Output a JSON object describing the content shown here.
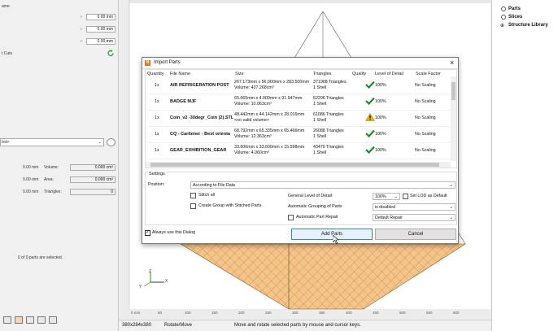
{
  "left_panel": {
    "name_label": "ame",
    "fields": [
      "0.00 mm",
      "0.00 mm",
      "0.00 mm"
    ],
    "cuts_label": "t Cuts",
    "dropdown_value": "led>",
    "stats": [
      {
        "value": "0.00 mm",
        "label": "Volume:",
        "box": "0.000 cm³"
      },
      {
        "value": "0.00 mm",
        "label": "Area:",
        "box": "0.000 cm²"
      },
      {
        "value": "0.00 mm",
        "label": "Triangles:",
        "box": "0"
      }
    ],
    "selection_text": "0 of 0 parts are selected."
  },
  "right_panel": {
    "tree": [
      "Parts",
      "Slices",
      "Structure Library"
    ]
  },
  "viewport": {
    "ruler_ticks": [
      "0 mm",
      "50",
      "100",
      "150",
      "200",
      "250",
      "300",
      "350",
      "400",
      "450",
      "500",
      "550",
      "600"
    ]
  },
  "status": {
    "dimensions": "380x284x380",
    "mode": "Rotate/Move",
    "hint": "Move and rotate selected parts by mouse and cursor keys."
  },
  "dialog": {
    "title": "Import Parts",
    "close": "×",
    "headers": {
      "quantity": "Quantity",
      "filename": "File Name",
      "size": "Size",
      "triangles": "Triangles",
      "quality": "Quality",
      "level": "Level of Detail",
      "scale": "Scale Factor"
    },
    "rows": [
      {
        "qty": "1x",
        "name": "AIR REFRIGERATION POST",
        "size1": "267.173mm x 56.000mm x 283.500mm",
        "size2": "Volume: 437.268cm³",
        "tri1": "371908 Triangles",
        "tri2": "1 Shell",
        "quality": "ok",
        "level": "100%",
        "scale": "No Scaling"
      },
      {
        "qty": "1x",
        "name": "BADGE MJF",
        "size1": "65.665mm x 4.000mm x 91.947mm",
        "size2": "Volume: 10.063cm³",
        "tri1": "52296 Triangles",
        "tri2": "1 Shell",
        "quality": "ok",
        "level": "100%",
        "scale": "No Scaling"
      },
      {
        "qty": "1x",
        "name": "Coin_v2 -30degr_Coin (2).STL",
        "size1": "48.442mm x 44.142mm x 28.016mm",
        "size2": "<no valid volume>",
        "tri1": "61086 Triangles",
        "tri2": "1 Shell",
        "quality": "warn",
        "level": "100%",
        "scale": "No Scaling"
      },
      {
        "qty": "1x",
        "name": "CQ - Caribiner - Best orienta",
        "size1": "68.792mm x 65.335mm x 65.466mm",
        "size2": "Volume: 12.363cm³",
        "tri1": "26088 Triangles",
        "tri2": "1 Shell",
        "quality": "ok",
        "level": "100%",
        "scale": "No Scaling"
      },
      {
        "qty": "1x",
        "name": "GEAR_EXHIBITION_GEAR",
        "size1": "33.600mm x 33.600mm x 15.598mm",
        "size2": "Volume: 4.060cm³",
        "tri1": "43470 Triangles",
        "tri2": "1 Shell",
        "quality": "ok",
        "level": "100%",
        "scale": "No Scaling"
      }
    ],
    "settings_label": "Settings",
    "position_label": "Position:",
    "position_value": "According to File Data",
    "stitch_all": "Stitch all",
    "create_group": "Create Group with Stitched Parts",
    "general_lod_label": "General Level of Detail:",
    "general_lod_value": "100%",
    "set_lod_default": "Set LOD as Default",
    "auto_grouping_label": "Automatic Grouping of Parts",
    "auto_grouping_value": "is disabled",
    "auto_repair_label": "Automatic Part Repair",
    "auto_repair_value": "Default Repair",
    "always_use": "Always use this Dialog",
    "add_parts": "Add Parts",
    "cancel": "Cancel"
  },
  "colors": {
    "check_green": "#1f8a2e",
    "warn_yellow": "#f0b400",
    "grid_orange": "#f5c489",
    "logo_orange": "#e77b1a"
  }
}
